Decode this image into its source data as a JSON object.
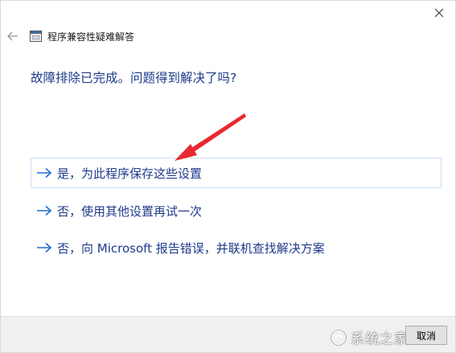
{
  "window": {
    "title": "程序兼容性疑难解答"
  },
  "heading": "故障排除已完成。问题得到解决了吗?",
  "options": [
    {
      "label": "是，为此程序保存这些设置"
    },
    {
      "label": "否，使用其他设置再试一次"
    },
    {
      "label": "否，向 Microsoft 报告错误，并联机查找解决方案"
    }
  ],
  "footer": {
    "cancel_label": "取消"
  },
  "watermark": {
    "text": "系统之家"
  },
  "colors": {
    "link": "#1e3a8a",
    "annotation": "#e8292f",
    "hover_border": "#c9dff2"
  },
  "icons": {
    "close": "close-icon",
    "back": "back-arrow-icon",
    "app": "program-compatibility-icon",
    "option_arrow": "right-arrow-icon"
  }
}
